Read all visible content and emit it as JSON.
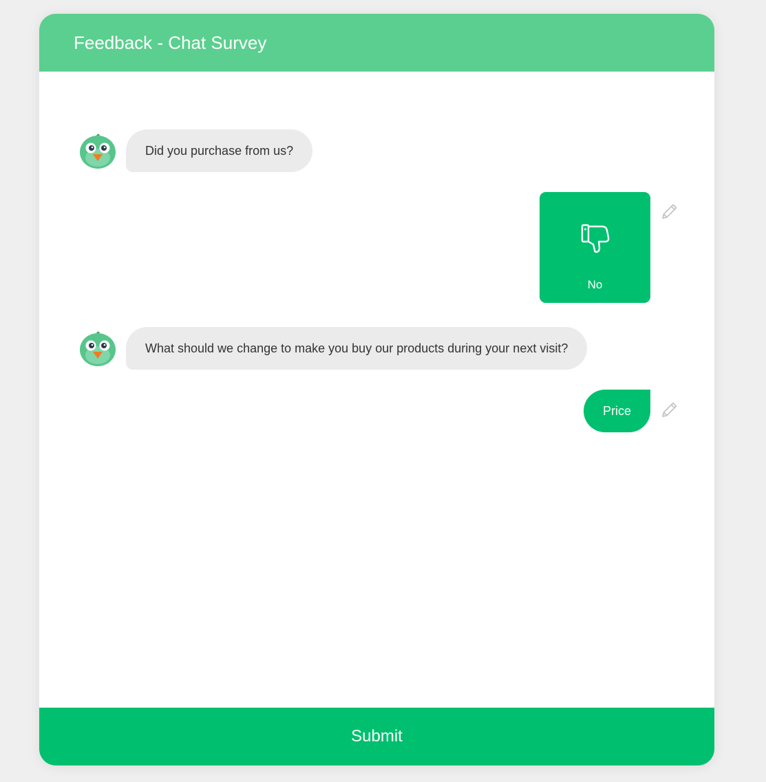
{
  "header": {
    "title": "Feedback - Chat Survey"
  },
  "messages": [
    {
      "from": "bot",
      "text": "Did you purchase from us?"
    },
    {
      "from": "user",
      "answer_type": "card",
      "icon": "thumbs-down-icon",
      "text": "No"
    },
    {
      "from": "bot",
      "text": "What should we change to make you buy our products during your next visit?"
    },
    {
      "from": "user",
      "answer_type": "pill",
      "text": "Price"
    }
  ],
  "footer": {
    "submit_label": "Submit"
  },
  "colors": {
    "header": "#5bcf8f",
    "accent": "#00bf6f",
    "bot_bubble": "#ebebeb",
    "background": "#efefef"
  }
}
